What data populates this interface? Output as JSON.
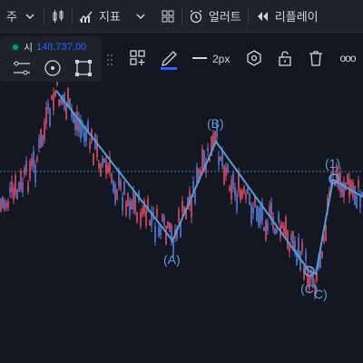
{
  "toolbar": {
    "period_label": "주",
    "indicators_label": "지표",
    "alert_label": "얼러트",
    "replay_label": "리플레이"
  },
  "drawing_toolbar": {
    "price_prefix": "시",
    "price_value": "148,737,00",
    "line_width_label": "2px",
    "more_label": "ooo"
  },
  "chart": {
    "wave_labels": {
      "A": "(A)",
      "B": "(B)",
      "C_overlap": "(C)",
      "C": "C)",
      "one": "(1)"
    },
    "colors": {
      "background": "#131722",
      "up_candle": "#5b7bd8",
      "down_candle": "#e04f6a",
      "wave_line": "#5b9bd5",
      "dotted_line": "#4a6fa5"
    }
  }
}
